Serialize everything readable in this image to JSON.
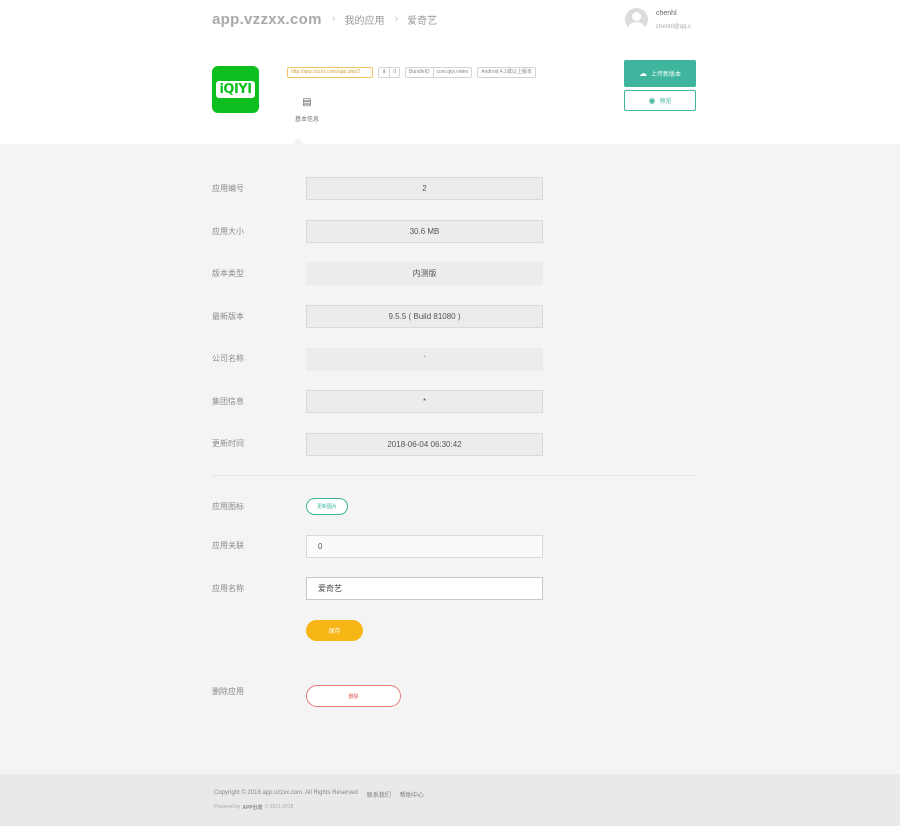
{
  "breadcrumb": {
    "brand": "app.vzzxx.com",
    "sep": "›",
    "items": [
      "我的应用",
      "爱奇艺"
    ]
  },
  "user": {
    "name": "chenhl",
    "email": "chenhl@qq.c"
  },
  "app": {
    "icon_text": "iQIYI",
    "icon_color": "#0dbf1e",
    "tags": {
      "url": "http://app.vzzxx.com/app.php/2",
      "count": "0",
      "bundle_label": "BundleID",
      "bundle_id": "com.qiyi.video",
      "android": "Android 4.1或以上版本"
    }
  },
  "tab": {
    "icon": "document-icon",
    "label": "基本信息"
  },
  "actions": {
    "upload_label": "上传新版本",
    "preview_label": "预览"
  },
  "info_rows": [
    {
      "label": "应用编号",
      "value": "2"
    },
    {
      "label": "应用大小",
      "value": "30.6 MB"
    },
    {
      "label": "版本类型",
      "value": "内测版"
    },
    {
      "label": "最新版本",
      "value": "9.5.5 ( Build 81080 )"
    },
    {
      "label": "公司名称",
      "value": "`"
    },
    {
      "label": "集团信息",
      "value": "*"
    },
    {
      "label": "更新时间",
      "value": "2018-06-04 06:30:42"
    }
  ],
  "edit": {
    "icon_label": "应用图标",
    "icon_button": "更新图片",
    "link_label": "应用关联",
    "link_value": "0",
    "name_label": "应用名称",
    "name_value": "爱奇艺",
    "save_label": "保存",
    "delete_row_label": "删除应用",
    "delete_label": "删除"
  },
  "footer": {
    "copyright": "Copyright © 2018 app.vzzxx.com. All Rights Reserved",
    "contact": "联系我们",
    "help": "帮助中心",
    "powered_prefix": "Powered by",
    "powered_brand": "APP分发",
    "powered_suffix": "© 2011-2018"
  },
  "colors": {
    "accent": "#3fb59d",
    "save": "#f7b615",
    "danger": "#e05656"
  }
}
